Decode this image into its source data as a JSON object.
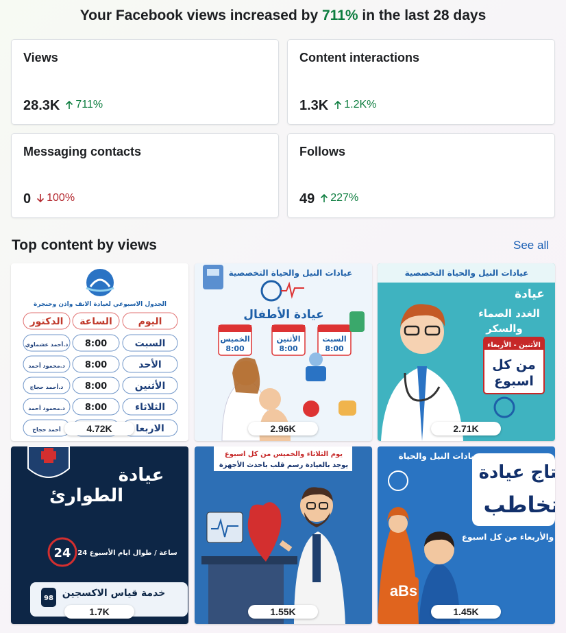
{
  "headline": {
    "prefix": "Your Facebook views increased by ",
    "pct": "711%",
    "suffix": " in the last 28 days"
  },
  "metrics": [
    {
      "title": "Views",
      "value": "28.3K",
      "change": "711%",
      "direction": "up"
    },
    {
      "title": "Content interactions",
      "value": "1.3K",
      "change": "1.2K%",
      "direction": "up"
    },
    {
      "title": "Messaging contacts",
      "value": "0",
      "change": "100%",
      "direction": "down"
    },
    {
      "title": "Follows",
      "value": "49",
      "change": "227%",
      "direction": "up"
    }
  ],
  "top_content": {
    "title": "Top content by views",
    "see_all": "See all",
    "items": [
      {
        "views": "4.72K"
      },
      {
        "views": "2.96K"
      },
      {
        "views": "2.71K"
      },
      {
        "views": "1.7K"
      },
      {
        "views": "1.55K"
      },
      {
        "views": "1.45K"
      }
    ]
  },
  "thumb_text": {
    "t1": {
      "header": "الجدول الاسبوعي لعيادة الانف واذن وحنجرة",
      "col_day": "اليوم",
      "col_time": "الساعة",
      "col_doc": "الدكتور",
      "rows": [
        {
          "day": "السبت",
          "time": "8:00",
          "doc": "د.أحمد عشماوي"
        },
        {
          "day": "الأحد",
          "time": "8:00",
          "doc": "د.محمود أحمد"
        },
        {
          "day": "الأثنين",
          "time": "8:00",
          "doc": "د.أحمد حجاج"
        },
        {
          "day": "الثلاثاء",
          "time": "8:00",
          "doc": "د.محمود أحمد"
        },
        {
          "day": "الاربعا",
          "time": "8:00",
          "doc": "أحمد حجاج"
        }
      ]
    },
    "t2": {
      "header": "عيادات النيل والحياة التخصصية",
      "title": "عيادة الأطفال",
      "d1": "الخميس",
      "d2": "الأثنين",
      "d3": "السبت",
      "time": "8:00"
    },
    "t3": {
      "header": "عيادات النيل والحياة التخصصية",
      "title1": "عيادة",
      "title2": "الغدد الصماء",
      "title3": "والسكر",
      "days": "الأثنين - الأربعاء",
      "weekly1": "من كل",
      "weekly2": "اسبوع"
    },
    "t4": {
      "title1": "عيادة",
      "title2": "الطوارئ",
      "hours": "24",
      "line": "24 ساعة / طوال ايام الأسبوع",
      "service": "خدمة قياس الاكسجين",
      "num": "98"
    },
    "t5": {
      "line1": "يوم الثلاثاء والخميس من كل اسبوع",
      "line2": "يوجد بالعيادة رسم قلب باحدث الأجهزة"
    },
    "t6": {
      "header": "عيادات النيل والحياة",
      "title1": "نتاج عيادة",
      "title2": "تخاطب",
      "line": "والأربعاء من كل اسبوع",
      "abc": "aBs"
    }
  },
  "colors": {
    "up": "#0d7d3f",
    "down": "#b3262d",
    "link": "#1a5fb4"
  }
}
